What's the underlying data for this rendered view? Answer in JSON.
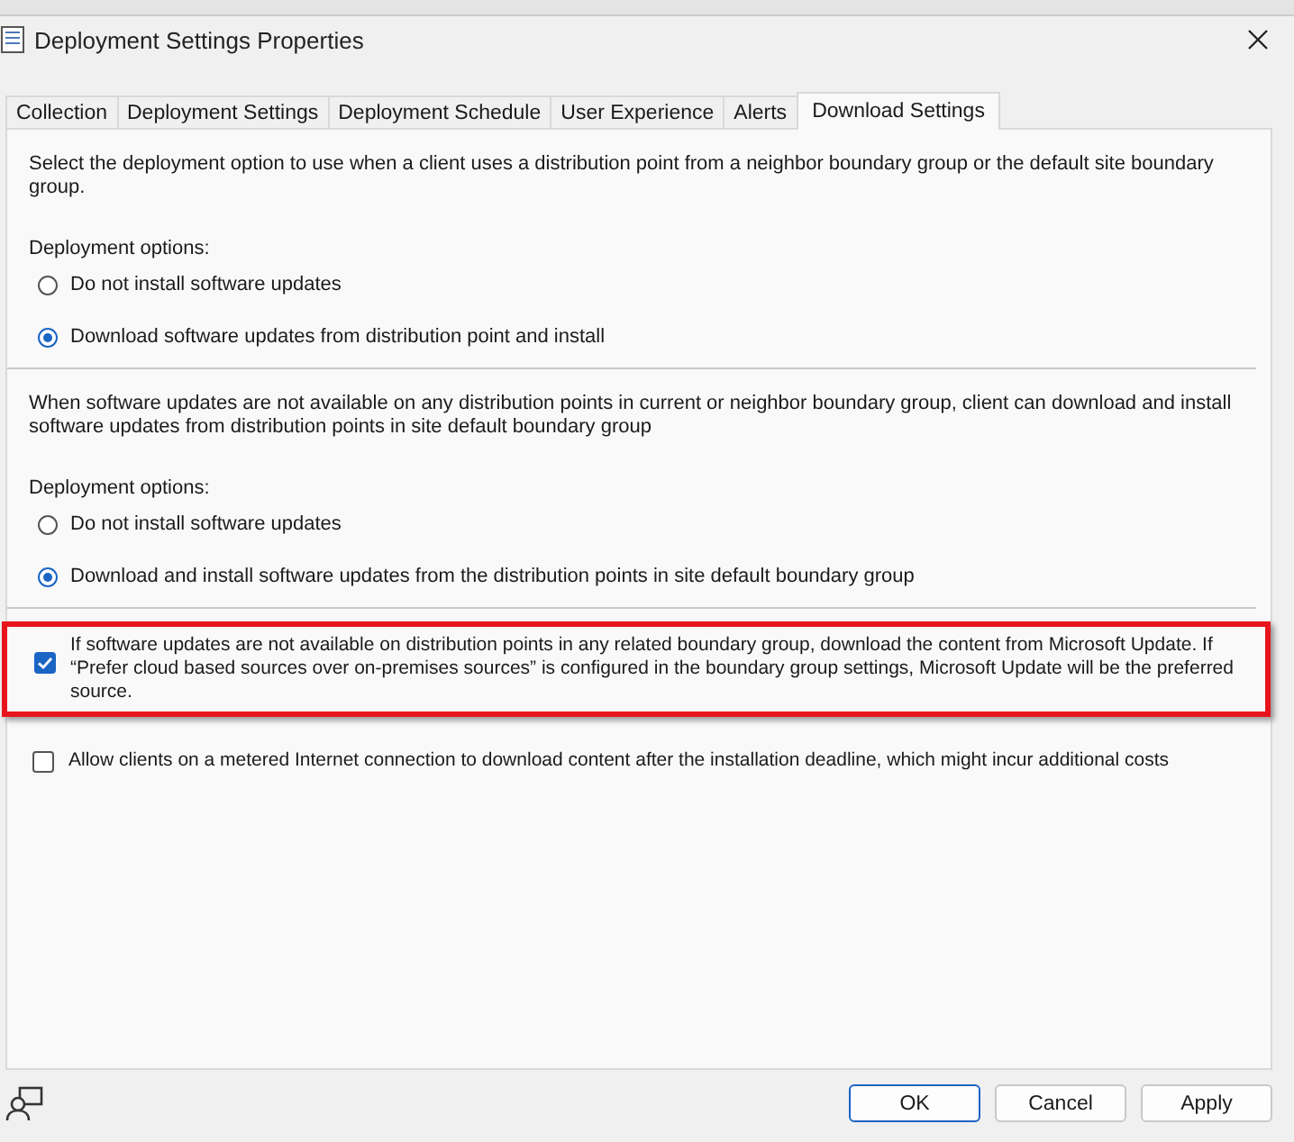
{
  "window": {
    "title": "Deployment Settings Properties"
  },
  "tabs": [
    {
      "label": "Collection",
      "selected": false
    },
    {
      "label": "Deployment Settings",
      "selected": false
    },
    {
      "label": "Deployment Schedule",
      "selected": false
    },
    {
      "label": "User Experience",
      "selected": false
    },
    {
      "label": "Alerts",
      "selected": false
    },
    {
      "label": "Download Settings",
      "selected": true
    }
  ],
  "sections": [
    {
      "description": "Select the deployment option to use when a client uses a distribution point from a neighbor boundary group or the default site boundary group.",
      "options_label": "Deployment options:",
      "options": [
        {
          "label": "Do not install software updates",
          "selected": false
        },
        {
          "label": "Download software updates from distribution point and install",
          "selected": true
        }
      ]
    },
    {
      "description": "When software updates are not available on any distribution points in current or neighbor boundary group, client can download and install software updates from distribution points in site default boundary group",
      "options_label": "Deployment options:",
      "options": [
        {
          "label": "Do not install software updates",
          "selected": false
        },
        {
          "label": "Download and install software updates from the distribution points in site default boundary group",
          "selected": true
        }
      ]
    }
  ],
  "checkboxes": [
    {
      "label": "If software updates are not available on distribution points in any related boundary group, download the content from Microsoft Update. If “Prefer cloud based sources over on-premises sources” is configured in the boundary group settings, Microsoft Update will be the preferred source.",
      "checked": true,
      "highlighted": true
    },
    {
      "label": "Allow clients on a metered Internet connection to download content after the installation deadline, which might incur additional costs",
      "checked": false,
      "highlighted": false
    }
  ],
  "buttons": [
    {
      "label": "OK",
      "default": true
    },
    {
      "label": "Cancel",
      "default": false
    },
    {
      "label": "Apply",
      "default": false
    }
  ]
}
